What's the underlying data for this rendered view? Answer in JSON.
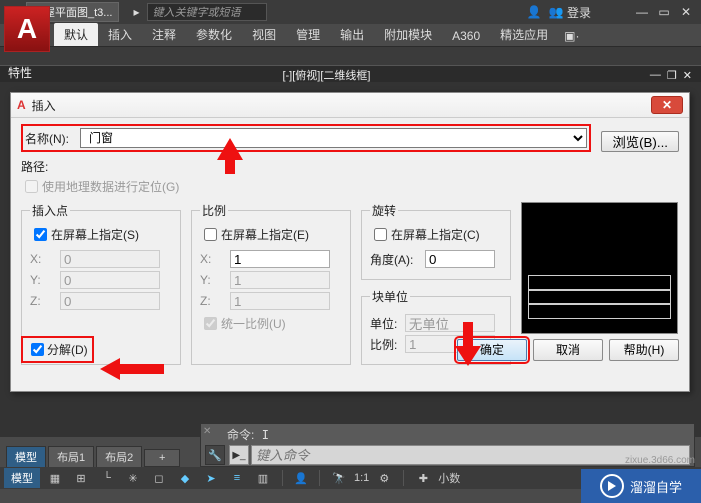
{
  "titlebar": {
    "doc_name": "房屋平面图_t3...",
    "search_placeholder": "键入关键字或短语",
    "login": "登录"
  },
  "ribbon": {
    "tabs": [
      "默认",
      "插入",
      "注释",
      "参数化",
      "视图",
      "管理",
      "输出",
      "附加模块",
      "A360",
      "精选应用"
    ],
    "active": "默认"
  },
  "properties_label": "特性",
  "view_caption": "[-][俯视][二维线框]",
  "dialog": {
    "title": "插入",
    "name_label": "名称(N):",
    "name_value": "门窗",
    "browse": "浏览(B)...",
    "path_label": "路径:",
    "geo_label": "使用地理数据进行定位(G)",
    "grp_insert": {
      "legend": "插入点",
      "onscreen_label": "在屏幕上指定(S)",
      "onscreen_checked": true,
      "x_label": "X:",
      "x_val": "0",
      "y_label": "Y:",
      "y_val": "0",
      "z_label": "Z:",
      "z_val": "0"
    },
    "grp_scale": {
      "legend": "比例",
      "onscreen_label": "在屏幕上指定(E)",
      "onscreen_checked": false,
      "x_label": "X:",
      "x_val": "1",
      "y_label": "Y:",
      "y_val": "1",
      "z_label": "Z:",
      "z_val": "1",
      "uniform_label": "统一比例(U)",
      "uniform_checked": true
    },
    "grp_rotate": {
      "legend": "旋转",
      "onscreen_label": "在屏幕上指定(C)",
      "onscreen_checked": false,
      "angle_label": "角度(A):",
      "angle_val": "0"
    },
    "grp_units": {
      "legend": "块单位",
      "unit_label": "单位:",
      "unit_val": "无单位",
      "ratio_label": "比例:",
      "ratio_val": "1"
    },
    "explode_label": "分解(D)",
    "explode_checked": true,
    "ok": "确定",
    "cancel": "取消",
    "help": "帮助(H)"
  },
  "cmd": {
    "echo_label": "命令:",
    "echo_value": "I",
    "placeholder": "键入命令"
  },
  "layout_tabs": {
    "model": "模型",
    "tab1": "布局1",
    "tab2": "布局2",
    "plus": "+"
  },
  "status": {
    "model": "模型",
    "paper_btn": "#",
    "gear": "⚙",
    "scale": "1:1",
    "annoscale": "小数"
  },
  "watermark": {
    "text": "溜溜自学",
    "url": "zixue.3d66.com"
  }
}
